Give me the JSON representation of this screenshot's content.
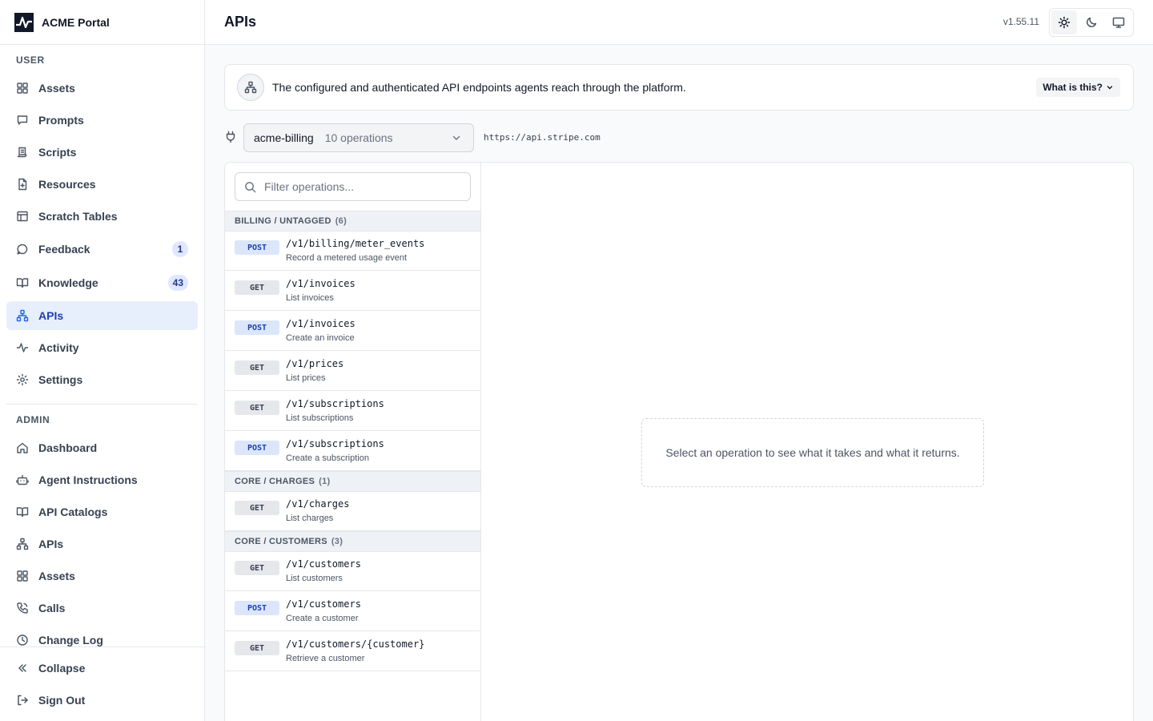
{
  "brand": {
    "name": "ACME Portal"
  },
  "header": {
    "title": "APIs",
    "version": "v1.55.11"
  },
  "sidebar": {
    "user_label": "USER",
    "user_items": [
      {
        "label": "Assets",
        "icon": "grid-icon"
      },
      {
        "label": "Prompts",
        "icon": "message-square-icon"
      },
      {
        "label": "Scripts",
        "icon": "script-icon"
      },
      {
        "label": "Resources",
        "icon": "file-plus-icon"
      },
      {
        "label": "Scratch Tables",
        "icon": "table-icon"
      },
      {
        "label": "Feedback",
        "icon": "message-circle-icon",
        "badge": "1"
      },
      {
        "label": "Knowledge",
        "icon": "book-open-icon",
        "badge": "43"
      },
      {
        "label": "APIs",
        "icon": "network-icon",
        "active": true
      },
      {
        "label": "Activity",
        "icon": "activity-icon"
      },
      {
        "label": "Settings",
        "icon": "gear-icon"
      }
    ],
    "admin_label": "ADMIN",
    "admin_items": [
      {
        "label": "Dashboard",
        "icon": "home-icon"
      },
      {
        "label": "Agent Instructions",
        "icon": "bot-icon"
      },
      {
        "label": "API Catalogs",
        "icon": "book-open-icon"
      },
      {
        "label": "APIs",
        "icon": "network-icon"
      },
      {
        "label": "Assets",
        "icon": "grid-icon"
      },
      {
        "label": "Calls",
        "icon": "phone-icon"
      },
      {
        "label": "Change Log",
        "icon": "clock-icon"
      }
    ],
    "footer": {
      "collapse": "Collapse",
      "sign_out": "Sign Out"
    }
  },
  "banner": {
    "text": "The configured and authenticated API endpoints agents reach through the platform.",
    "what_label": "What is this?"
  },
  "selector": {
    "api_name": "acme-billing",
    "ops_label": "10 operations",
    "base_url": "https://api.stripe.com"
  },
  "filter": {
    "placeholder": "Filter operations..."
  },
  "groups": [
    {
      "name": "BILLING / UNTAGGED",
      "count": "(6)",
      "ops": [
        {
          "method": "POST",
          "path": "/v1/billing/meter_events",
          "desc": "Record a metered usage event"
        },
        {
          "method": "GET",
          "path": "/v1/invoices",
          "desc": "List invoices"
        },
        {
          "method": "POST",
          "path": "/v1/invoices",
          "desc": "Create an invoice"
        },
        {
          "method": "GET",
          "path": "/v1/prices",
          "desc": "List prices"
        },
        {
          "method": "GET",
          "path": "/v1/subscriptions",
          "desc": "List subscriptions"
        },
        {
          "method": "POST",
          "path": "/v1/subscriptions",
          "desc": "Create a subscription"
        }
      ]
    },
    {
      "name": "CORE / CHARGES",
      "count": "(1)",
      "ops": [
        {
          "method": "GET",
          "path": "/v1/charges",
          "desc": "List charges"
        }
      ]
    },
    {
      "name": "CORE / CUSTOMERS",
      "count": "(3)",
      "ops": [
        {
          "method": "GET",
          "path": "/v1/customers",
          "desc": "List customers"
        },
        {
          "method": "POST",
          "path": "/v1/customers",
          "desc": "Create a customer"
        },
        {
          "method": "GET",
          "path": "/v1/customers/{customer}",
          "desc": "Retrieve a customer"
        }
      ]
    }
  ],
  "empty_state": {
    "text": "Select an operation to see what it takes and what it returns."
  },
  "colors": {
    "accent": "#2563eb",
    "active_bg": "#e8effc",
    "post_badge": "#dbe6fb"
  }
}
